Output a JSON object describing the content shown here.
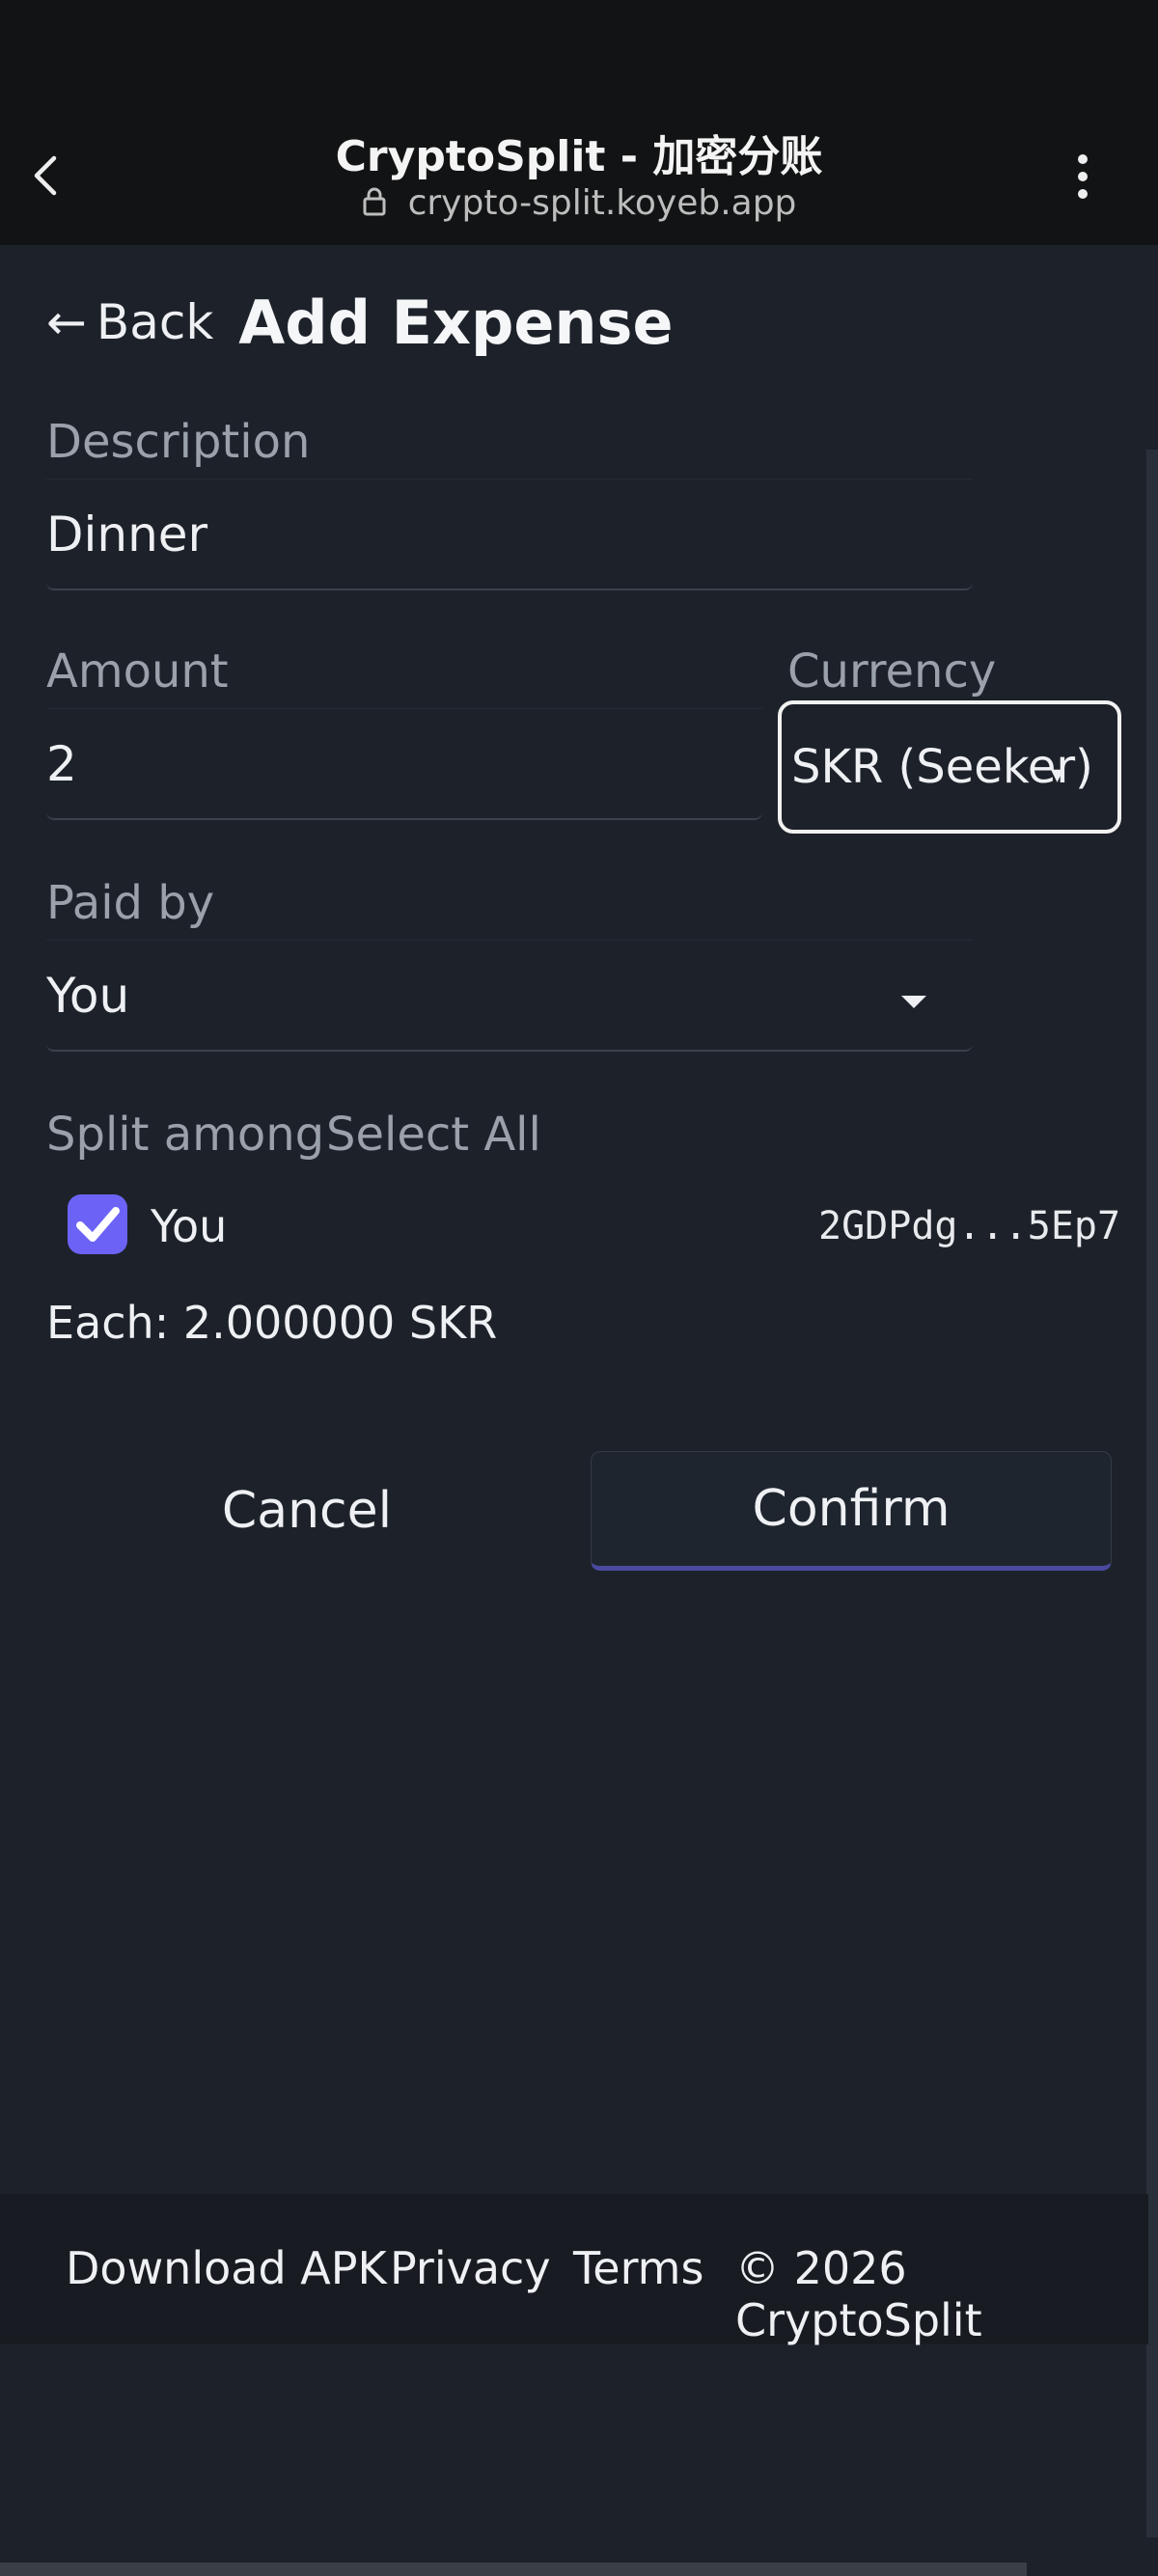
{
  "browser": {
    "title": "CryptoSplit - 加密分账",
    "url": "crypto-split.koyeb.app"
  },
  "header": {
    "back_label": "Back",
    "back_arrow": "←",
    "title": "Add Expense"
  },
  "form": {
    "description_label": "Description",
    "description_value": "Dinner",
    "amount_label": "Amount",
    "amount_value": "2",
    "currency_label": "Currency",
    "currency_value": "SKR (Seeker)",
    "paid_by_label": "Paid by",
    "paid_by_value": "You",
    "split_label": "Split among",
    "select_all_label": "Select All",
    "split_members": [
      {
        "name": "You",
        "address": "2GDPdg...5Ep7",
        "checked": true
      }
    ],
    "each_text": "Each: 2.000000 SKR"
  },
  "actions": {
    "cancel_label": "Cancel",
    "confirm_label": "Confirm"
  },
  "footer": {
    "download": "Download APK",
    "privacy": "Privacy",
    "terms": "Terms",
    "copyright": "© 2026 CryptoSplit"
  },
  "colors": {
    "accent": "#6c63f6",
    "background": "#1d222a",
    "chrome": "#121314"
  }
}
